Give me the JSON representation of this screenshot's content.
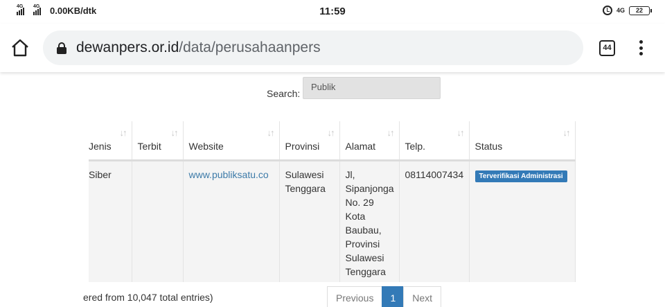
{
  "status_bar": {
    "network_label_1": "4G",
    "network_label_2": "4G",
    "speed": "0.00KB/dtk",
    "time": "11:59",
    "net_right": "4G",
    "battery": "22"
  },
  "browser": {
    "url_domain": "dewanpers.or.id",
    "url_path": "/data/perusahaanpers",
    "tab_count": "44"
  },
  "search": {
    "label": "Search:",
    "value": "Publik"
  },
  "table": {
    "columns": [
      "Jenis",
      "Terbit",
      "Website",
      "Provinsi",
      "Alamat",
      "Telp.",
      "Status"
    ],
    "rows": [
      {
        "jenis": "Siber",
        "terbit": "",
        "website": "www.publiksatu.co",
        "provinsi": "Sulawesi Tenggara",
        "alamat": "Jl, Sipanjonga No. 29 Kota Baubau, Provinsi Sulawesi Tenggara",
        "telp": "08114007434",
        "status": "Terverifikasi Administrasi"
      }
    ]
  },
  "footer": {
    "info": "ered from 10,047 total entries)",
    "prev_label": "Previous",
    "page_label": "1",
    "next_label": "Next"
  },
  "colors": {
    "accent": "#337ab7",
    "link": "#3c7aa8"
  }
}
